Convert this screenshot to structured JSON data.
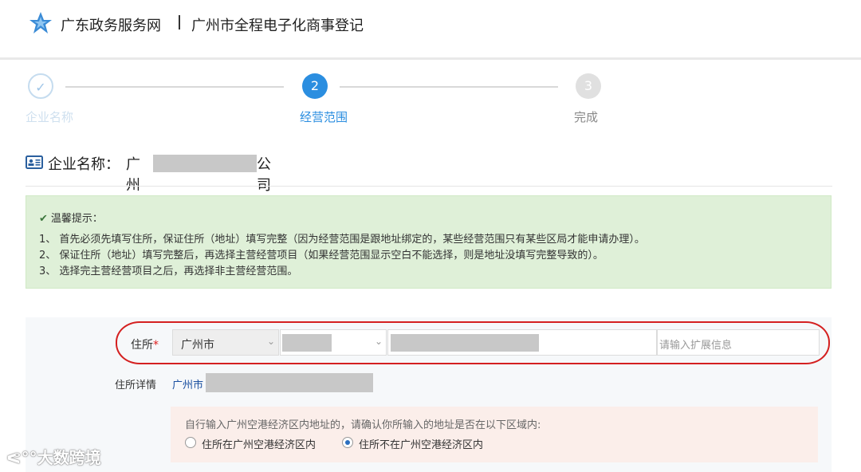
{
  "header": {
    "site_name": "广东政务服务网",
    "system_name": "广州市全程电子化商事登记"
  },
  "steps": [
    {
      "number": "",
      "label": "企业名称",
      "state": "done"
    },
    {
      "number": "2",
      "label": "经营范围",
      "state": "active"
    },
    {
      "number": "3",
      "label": "完成",
      "state": "todo"
    }
  ],
  "company": {
    "label": "企业名称：",
    "prefix": "广州",
    "suffix": "公司"
  },
  "tips": {
    "title": "温馨提示：",
    "lines": [
      "1、 首先必须先填写住所，保证住所（地址）填写完整（因为经营范围是跟地址绑定的，某些经营范围只有某些区局才能申请办理）。",
      "2、 保证住所（地址）填写完整后，再选择主营经营项目（如果经营范围显示空白不能选择，则是地址没填写完整导致的）。",
      "3、 选择完主营经营项目之后，再选择非主营经营范围。"
    ]
  },
  "address": {
    "label": "住所",
    "required_mark": "*",
    "city_value": "广州市",
    "ext_placeholder": "请输入扩展信息",
    "detail_label": "住所详情",
    "detail_city": "广州市"
  },
  "zone": {
    "prompt": "自行输入广州空港经济区内地址的，请确认你所输入的地址是否在以下区域内:",
    "options": [
      "住所在广州空港经济区内",
      "住所不在广州空港经济区内"
    ],
    "selected_index": 1
  },
  "watermark": "大数跨境",
  "colors": {
    "primary": "#2b8ee0",
    "tips_bg": "#dff0d8",
    "annotation": "#d42020"
  }
}
